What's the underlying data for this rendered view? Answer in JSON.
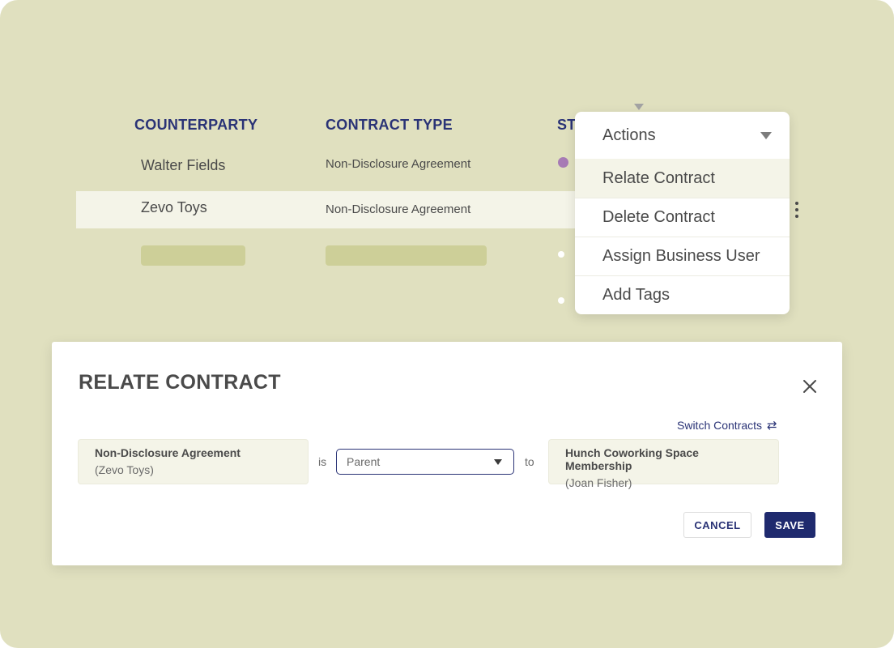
{
  "table": {
    "headers": {
      "counterparty": "COUNTERPARTY",
      "contract_type": "CONTRACT TYPE",
      "status_partial": "ST"
    },
    "rows": [
      {
        "counterparty": "Walter Fields",
        "contract_type": "Non-Disclosure Agreement",
        "status_dot_color": "#a77bb5"
      },
      {
        "counterparty": "Zevo Toys",
        "contract_type": "Non-Disclosure Agreement",
        "status_dot_color": ""
      }
    ],
    "placeholder_color": "#cdcf98",
    "row_actions_icon": "kebab-icon"
  },
  "actions_menu": {
    "header": "Actions",
    "items": [
      {
        "label": "Relate Contract",
        "active": true
      },
      {
        "label": "Delete Contract",
        "active": false
      },
      {
        "label": "Assign Business User",
        "active": false
      },
      {
        "label": "Add Tags",
        "active": false
      }
    ]
  },
  "modal": {
    "title": "RELATE CONTRACT",
    "switch_label": "Switch Contracts",
    "switch_icon": "swap-arrows-icon",
    "source": {
      "title": "Non-Disclosure Agreement",
      "party": "(Zevo Toys)"
    },
    "is_label": "is",
    "relation": {
      "value": "Parent"
    },
    "to_label": "to",
    "target": {
      "title": "Hunch Coworking Space Membership",
      "party": "(Joan Fisher)"
    },
    "cancel_label": "CANCEL",
    "save_label": "SAVE"
  },
  "colors": {
    "background": "#e0e0bf",
    "accent": "#2a3376",
    "primary_button": "#1f2a6e",
    "highlight_row": "#f4f4e8"
  }
}
